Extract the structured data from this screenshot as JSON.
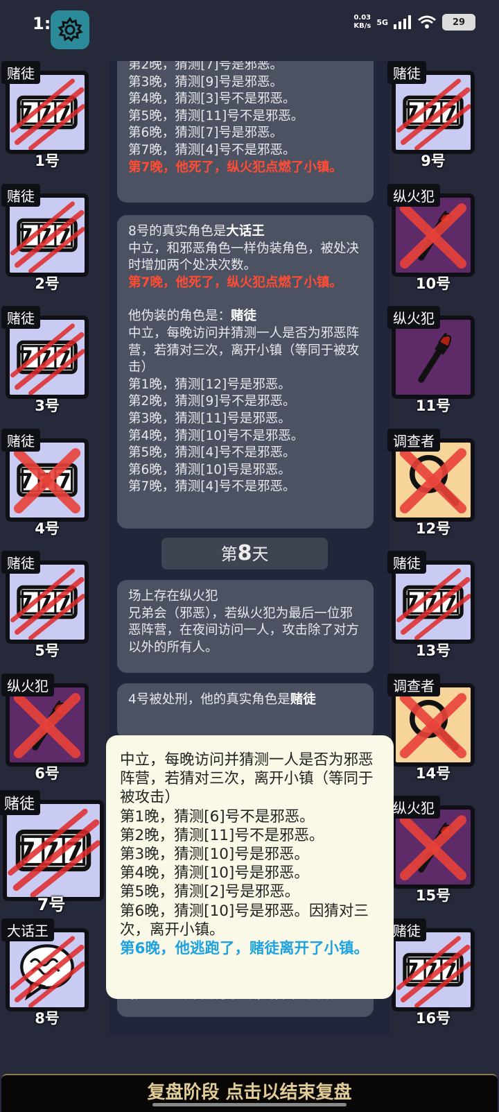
{
  "status_bar": {
    "time": "1:07",
    "net_speed_value": "0.03",
    "net_speed_unit": "KB/s",
    "network": "5G",
    "battery": "29"
  },
  "log": {
    "card1": [
      "第2晚，猜测[7]号是邪恶。",
      "第3晚，猜测[9]号是邪恶。",
      "第4晚，猜测[3]号不是邪恶。",
      "第5晚，猜测[11]号不是邪恶。",
      "第6晚，猜测[7]号是邪恶。",
      "第7晚，猜测[4]号不是邪恶。"
    ],
    "card1_death": "第7晚，他死了，纵火犯点燃了小镇。",
    "card2_intro": "8号的真实角色是",
    "card2_role": "大话王",
    "card2_desc": "中立，和邪恶角色一样伪装角色，被处决时增加两个处决次数。",
    "card2_death": "第7晚，他死了，纵火犯点燃了小镇。",
    "card2_disguise_intro": "他伪装的角色是：",
    "card2_disguise_role": "赌徒",
    "card2_disguise_desc": "中立，每晚访问并猜测一人是否为邪恶阵营，若猜对三次，离开小镇（等同于被攻击）",
    "card2_lines": [
      "第1晚，猜测[12]号是邪恶。",
      "第2晚，猜测[9]号不是邪恶。",
      "第3晚，猜测[11]号是邪恶。",
      "第4晚，猜测[10]号不是邪恶。",
      "第5晚，猜测[4]号不是邪恶。",
      "第6晚，猜测[10]号是邪恶。",
      "第7晚，猜测[4]号不是邪恶。"
    ],
    "day_prefix": "第",
    "day_number": "8",
    "day_suffix": "天",
    "card3_title": "场上存在纵火犯",
    "card3_desc": "兄弟会（邪恶），若纵火犯为最后一位邪恶阵营，在夜间访问一人，攻击除了对方以外的所有人。",
    "card4_intro": "4号被处刑，他的真实角色是",
    "card4_role": "赌徒",
    "card5": "邪恶的人数占据了多数，你因此失败"
  },
  "popup": {
    "desc": "中立，每晚访问并猜测一人是否为邪恶阵营，若猜对三次，离开小镇（等同于被攻击）",
    "lines": [
      "第1晚，猜测[6]号不是邪恶。",
      "第2晚，猜测[11]号不是邪恶。",
      "第3晚，猜测[10]号是邪恶。",
      "第4晚，猜测[10]号是邪恶。",
      "第5晚，猜测[2]号是邪恶。",
      "第6晚，猜测[10]号是邪恶。因猜对三次，离开小镇。"
    ],
    "escape": "第6晚，他逃跑了，赌徒离开了小镇。"
  },
  "players_left": [
    {
      "role": "赌徒",
      "number": "1号",
      "icon": "slot-777-icon",
      "dead_mark": "claw"
    },
    {
      "role": "赌徒",
      "number": "2号",
      "icon": "slot-777-icon",
      "dead_mark": "claw"
    },
    {
      "role": "赌徒",
      "number": "3号",
      "icon": "slot-777-icon",
      "dead_mark": "claw"
    },
    {
      "role": "赌徒",
      "number": "4号",
      "icon": "slot-777-icon",
      "dead_mark": "cross"
    },
    {
      "role": "赌徒",
      "number": "5号",
      "icon": "slot-777-icon",
      "dead_mark": "claw"
    },
    {
      "role": "纵火犯",
      "number": "6号",
      "icon": "torch-icon",
      "dead_mark": "cross"
    },
    {
      "role": "赌徒",
      "number": "7号",
      "icon": "slot-777-icon",
      "dead_mark": "claw"
    },
    {
      "role": "大话王",
      "number": "8号",
      "icon": "speech-bubble-icon",
      "dead_mark": "claw"
    }
  ],
  "players_right": [
    {
      "role": "赌徒",
      "number": "9号",
      "icon": "slot-777-icon",
      "dead_mark": "claw"
    },
    {
      "role": "纵火犯",
      "number": "10号",
      "icon": "torch-icon",
      "dead_mark": "cross"
    },
    {
      "role": "纵火犯",
      "number": "11号",
      "icon": "torch-icon",
      "dead_mark": "none"
    },
    {
      "role": "调查者",
      "number": "12号",
      "icon": "magnifier-icon",
      "dead_mark": "cross"
    },
    {
      "role": "赌徒",
      "number": "13号",
      "icon": "slot-777-icon",
      "dead_mark": "claw"
    },
    {
      "role": "调查者",
      "number": "14号",
      "icon": "magnifier-icon",
      "dead_mark": "cross"
    },
    {
      "role": "纵火犯",
      "number": "15号",
      "icon": "torch-icon",
      "dead_mark": "cross"
    },
    {
      "role": "赌徒",
      "number": "16号",
      "icon": "slot-777-icon",
      "dead_mark": "claw"
    }
  ],
  "slot_text": "777",
  "bottom_bar": {
    "label": "复盘阶段 点击以结束复盘"
  },
  "colors": {
    "death_text": "#ff4c33",
    "escape_text": "#1fa3e0",
    "gambler_bg": "#cacbf2",
    "arsonist_bg": "#5e2a68",
    "investigator_bg": "#f7d59a"
  }
}
